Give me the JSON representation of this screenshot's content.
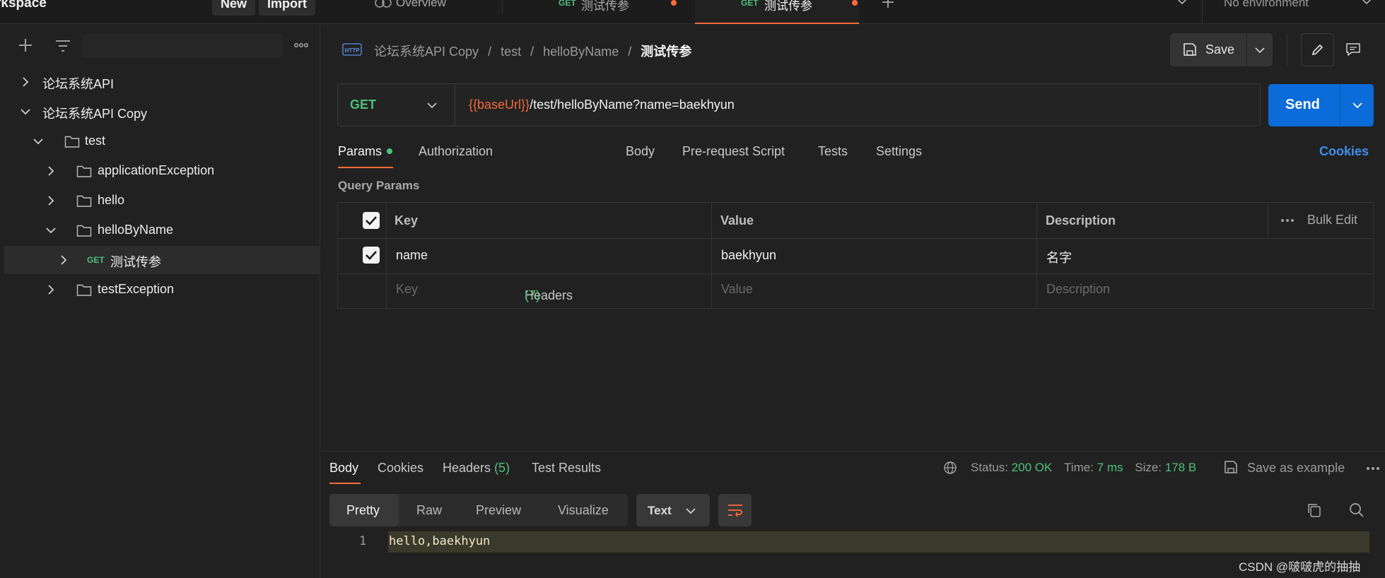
{
  "topbar": {
    "workspace_title": "rkspace",
    "new_label": "New",
    "import_label": "Import",
    "tabs": [
      {
        "method": "",
        "label": "Overview"
      },
      {
        "method": "GET",
        "label": "测试传参"
      },
      {
        "method": "GET",
        "label": "测试传参"
      }
    ],
    "environment": "No environment"
  },
  "sidebar": {
    "items": [
      {
        "label": "论坛系统API"
      },
      {
        "label": "论坛系统API Copy"
      },
      {
        "label": "test"
      },
      {
        "label": "applicationException"
      },
      {
        "label": "hello"
      },
      {
        "label": "helloByName"
      },
      {
        "method": "GET",
        "label": "测试传参"
      },
      {
        "label": "testException"
      }
    ]
  },
  "breadcrumb": {
    "parts": [
      "论坛系统API Copy",
      "test",
      "helloByName"
    ],
    "current": "测试传参",
    "separator": "/"
  },
  "toolbar": {
    "save_label": "Save"
  },
  "request": {
    "method": "GET",
    "url_var": "{{baseUrl}}",
    "url_path": "/test/helloByName?name=baekhyun",
    "send_label": "Send"
  },
  "request_tabs": {
    "params": "Params",
    "authorization": "Authorization",
    "headers": "Headers",
    "headers_count": "(7)",
    "body": "Body",
    "prerequest": "Pre-request Script",
    "tests": "Tests",
    "settings": "Settings",
    "cookies": "Cookies"
  },
  "query_params": {
    "title": "Query Params",
    "headers": {
      "key": "Key",
      "value": "Value",
      "description": "Description",
      "bulk_edit": "Bulk Edit"
    },
    "rows": [
      {
        "key": "name",
        "value": "baekhyun",
        "description": "名字"
      }
    ],
    "placeholder": {
      "key": "Key",
      "value": "Value",
      "description": "Description"
    }
  },
  "response": {
    "tabs": {
      "body": "Body",
      "cookies": "Cookies",
      "headers": "Headers",
      "headers_count": "(5)",
      "test_results": "Test Results"
    },
    "status_label": "Status:",
    "status_value": "200 OK",
    "time_label": "Time:",
    "time_value": "7 ms",
    "size_label": "Size:",
    "size_value": "178 B",
    "save_example": "Save as example",
    "view_tabs": [
      "Pretty",
      "Raw",
      "Preview",
      "Visualize"
    ],
    "format": "Text",
    "line_number": "1",
    "content": "hello,baekhyun"
  },
  "watermark": "CSDN @啵啵虎的抽抽",
  "colors": {
    "accent": "#ff6c37",
    "get": "#4ec07a",
    "send": "#0b6bd8",
    "cookies": "#3f8ef0",
    "status_ok": "#4ec07a"
  }
}
